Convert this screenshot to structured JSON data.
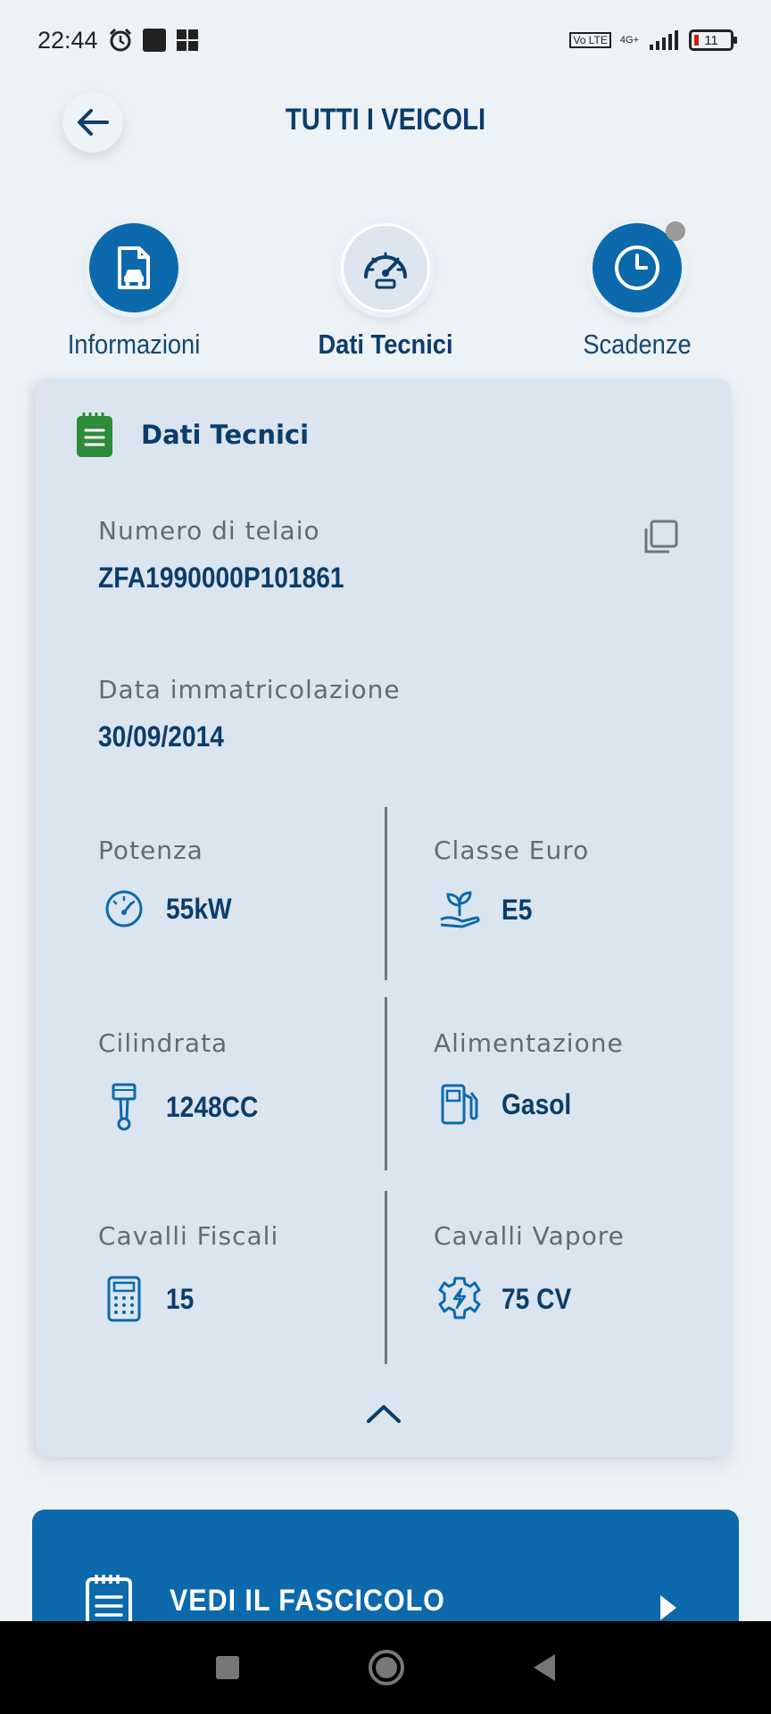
{
  "status_bar": {
    "time": "22:44",
    "volte": "Vo LTE",
    "network": "4G+",
    "battery": "11"
  },
  "header": {
    "title": "TUTTI I VEICOLI",
    "back_icon": "arrow-left-icon"
  },
  "tabs": [
    {
      "label": "Informazioni",
      "icon": "car-document-icon",
      "active": false
    },
    {
      "label": "Dati Tecnici",
      "icon": "speedometer-icon",
      "active": true
    },
    {
      "label": "Scadenze",
      "icon": "clock-icon",
      "active": false,
      "has_notification": true
    }
  ],
  "card": {
    "title": "Dati Tecnici",
    "icon": "notepad-icon",
    "vin": {
      "label": "Numero di telaio",
      "value": "ZFA1990000P101861"
    },
    "registration": {
      "label": "Data immatricolazione",
      "value": "30/09/2014"
    },
    "specs": [
      {
        "label": "Potenza",
        "value": "55kW",
        "icon": "gauge-icon"
      },
      {
        "label": "Classe Euro",
        "value": "E5",
        "icon": "eco-plant-hand-icon"
      },
      {
        "label": "Cilindrata",
        "value": "1248CC",
        "icon": "piston-icon"
      },
      {
        "label": "Alimentazione",
        "value": "Gasol",
        "icon": "fuel-pump-icon"
      },
      {
        "label": "Cavalli Fiscali",
        "value": "15",
        "icon": "calculator-icon"
      },
      {
        "label": "Cavalli Vapore",
        "value": "75 CV",
        "icon": "engine-gear-icon"
      }
    ]
  },
  "cta": {
    "label": "VEDI IL FASCICOLO",
    "icon": "document-list-icon"
  },
  "colors": {
    "primary": "#0b69ac",
    "title_text": "#0c3d6b",
    "card_bg": "#dbe5ef",
    "page_bg": "#edf2f6",
    "accent_green": "#2e8b3a"
  }
}
